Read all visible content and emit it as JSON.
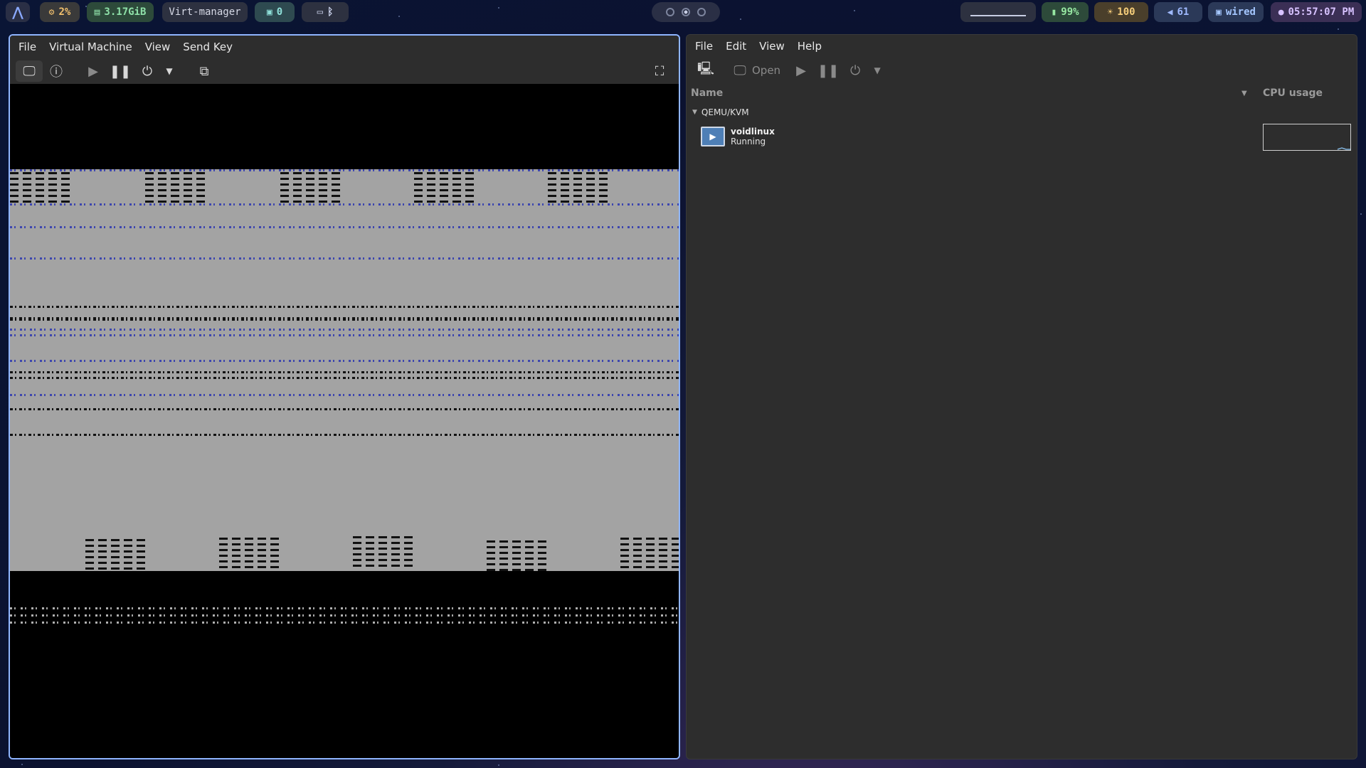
{
  "topbar": {
    "cpu": "2%",
    "memory": "3.17GiB",
    "active_window": "Virt-manager",
    "workspace": "0",
    "battery": "99%",
    "brightness": "100",
    "volume": "61",
    "network": "wired",
    "clock": "05:57:07 PM"
  },
  "vm_window": {
    "menu": [
      "File",
      "Virtual Machine",
      "View",
      "Send Key"
    ]
  },
  "manager_window": {
    "menu": [
      "File",
      "Edit",
      "View",
      "Help"
    ],
    "toolbar_open_label": "Open",
    "columns": {
      "name": "Name",
      "cpu": "CPU usage"
    },
    "group": "QEMU/KVM",
    "vms": [
      {
        "name": "voidlinux",
        "status": "Running"
      }
    ]
  },
  "colors": {
    "accent": "#8fb5ff",
    "window_bg": "#2d2d2d",
    "guest_gray": "#a3a3a3",
    "noise_blue": "#2b36b0"
  }
}
